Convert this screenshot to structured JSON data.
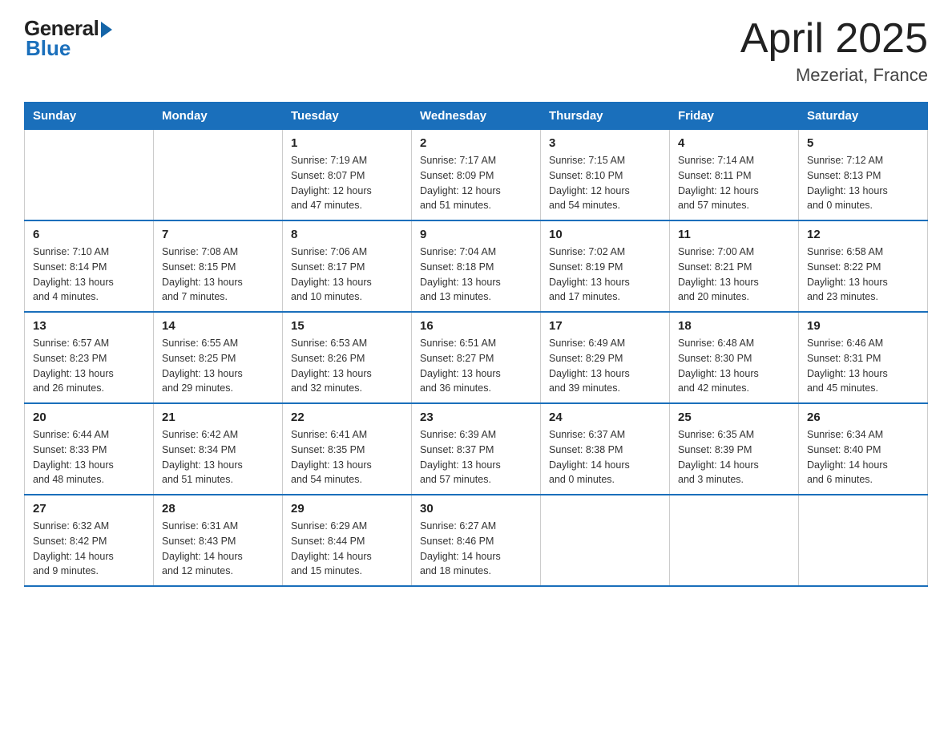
{
  "logo": {
    "general": "General",
    "blue": "Blue"
  },
  "title": "April 2025",
  "subtitle": "Mezeriat, France",
  "days_of_week": [
    "Sunday",
    "Monday",
    "Tuesday",
    "Wednesday",
    "Thursday",
    "Friday",
    "Saturday"
  ],
  "weeks": [
    [
      {
        "day": "",
        "info": ""
      },
      {
        "day": "",
        "info": ""
      },
      {
        "day": "1",
        "info": "Sunrise: 7:19 AM\nSunset: 8:07 PM\nDaylight: 12 hours\nand 47 minutes."
      },
      {
        "day": "2",
        "info": "Sunrise: 7:17 AM\nSunset: 8:09 PM\nDaylight: 12 hours\nand 51 minutes."
      },
      {
        "day": "3",
        "info": "Sunrise: 7:15 AM\nSunset: 8:10 PM\nDaylight: 12 hours\nand 54 minutes."
      },
      {
        "day": "4",
        "info": "Sunrise: 7:14 AM\nSunset: 8:11 PM\nDaylight: 12 hours\nand 57 minutes."
      },
      {
        "day": "5",
        "info": "Sunrise: 7:12 AM\nSunset: 8:13 PM\nDaylight: 13 hours\nand 0 minutes."
      }
    ],
    [
      {
        "day": "6",
        "info": "Sunrise: 7:10 AM\nSunset: 8:14 PM\nDaylight: 13 hours\nand 4 minutes."
      },
      {
        "day": "7",
        "info": "Sunrise: 7:08 AM\nSunset: 8:15 PM\nDaylight: 13 hours\nand 7 minutes."
      },
      {
        "day": "8",
        "info": "Sunrise: 7:06 AM\nSunset: 8:17 PM\nDaylight: 13 hours\nand 10 minutes."
      },
      {
        "day": "9",
        "info": "Sunrise: 7:04 AM\nSunset: 8:18 PM\nDaylight: 13 hours\nand 13 minutes."
      },
      {
        "day": "10",
        "info": "Sunrise: 7:02 AM\nSunset: 8:19 PM\nDaylight: 13 hours\nand 17 minutes."
      },
      {
        "day": "11",
        "info": "Sunrise: 7:00 AM\nSunset: 8:21 PM\nDaylight: 13 hours\nand 20 minutes."
      },
      {
        "day": "12",
        "info": "Sunrise: 6:58 AM\nSunset: 8:22 PM\nDaylight: 13 hours\nand 23 minutes."
      }
    ],
    [
      {
        "day": "13",
        "info": "Sunrise: 6:57 AM\nSunset: 8:23 PM\nDaylight: 13 hours\nand 26 minutes."
      },
      {
        "day": "14",
        "info": "Sunrise: 6:55 AM\nSunset: 8:25 PM\nDaylight: 13 hours\nand 29 minutes."
      },
      {
        "day": "15",
        "info": "Sunrise: 6:53 AM\nSunset: 8:26 PM\nDaylight: 13 hours\nand 32 minutes."
      },
      {
        "day": "16",
        "info": "Sunrise: 6:51 AM\nSunset: 8:27 PM\nDaylight: 13 hours\nand 36 minutes."
      },
      {
        "day": "17",
        "info": "Sunrise: 6:49 AM\nSunset: 8:29 PM\nDaylight: 13 hours\nand 39 minutes."
      },
      {
        "day": "18",
        "info": "Sunrise: 6:48 AM\nSunset: 8:30 PM\nDaylight: 13 hours\nand 42 minutes."
      },
      {
        "day": "19",
        "info": "Sunrise: 6:46 AM\nSunset: 8:31 PM\nDaylight: 13 hours\nand 45 minutes."
      }
    ],
    [
      {
        "day": "20",
        "info": "Sunrise: 6:44 AM\nSunset: 8:33 PM\nDaylight: 13 hours\nand 48 minutes."
      },
      {
        "day": "21",
        "info": "Sunrise: 6:42 AM\nSunset: 8:34 PM\nDaylight: 13 hours\nand 51 minutes."
      },
      {
        "day": "22",
        "info": "Sunrise: 6:41 AM\nSunset: 8:35 PM\nDaylight: 13 hours\nand 54 minutes."
      },
      {
        "day": "23",
        "info": "Sunrise: 6:39 AM\nSunset: 8:37 PM\nDaylight: 13 hours\nand 57 minutes."
      },
      {
        "day": "24",
        "info": "Sunrise: 6:37 AM\nSunset: 8:38 PM\nDaylight: 14 hours\nand 0 minutes."
      },
      {
        "day": "25",
        "info": "Sunrise: 6:35 AM\nSunset: 8:39 PM\nDaylight: 14 hours\nand 3 minutes."
      },
      {
        "day": "26",
        "info": "Sunrise: 6:34 AM\nSunset: 8:40 PM\nDaylight: 14 hours\nand 6 minutes."
      }
    ],
    [
      {
        "day": "27",
        "info": "Sunrise: 6:32 AM\nSunset: 8:42 PM\nDaylight: 14 hours\nand 9 minutes."
      },
      {
        "day": "28",
        "info": "Sunrise: 6:31 AM\nSunset: 8:43 PM\nDaylight: 14 hours\nand 12 minutes."
      },
      {
        "day": "29",
        "info": "Sunrise: 6:29 AM\nSunset: 8:44 PM\nDaylight: 14 hours\nand 15 minutes."
      },
      {
        "day": "30",
        "info": "Sunrise: 6:27 AM\nSunset: 8:46 PM\nDaylight: 14 hours\nand 18 minutes."
      },
      {
        "day": "",
        "info": ""
      },
      {
        "day": "",
        "info": ""
      },
      {
        "day": "",
        "info": ""
      }
    ]
  ]
}
